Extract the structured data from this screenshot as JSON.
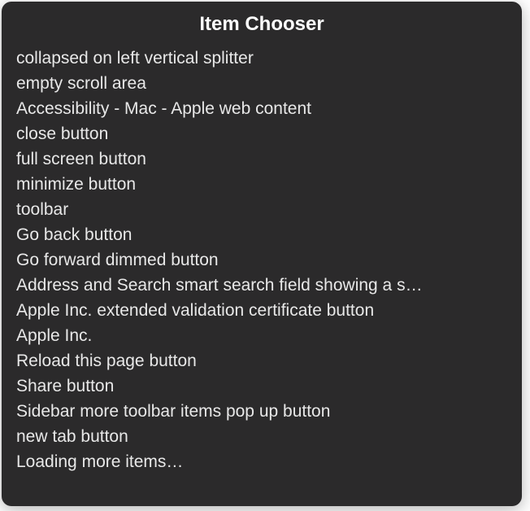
{
  "title": "Item Chooser",
  "items": [
    "collapsed on left vertical splitter",
    "empty scroll area",
    "Accessibility - Mac - Apple web content",
    "close button",
    "full screen button",
    "minimize button",
    "toolbar",
    "Go back button",
    "Go forward dimmed button",
    "Address and Search smart search field showing a s…",
    "Apple Inc. extended validation certificate button",
    "Apple Inc.",
    "Reload this page button",
    "Share button",
    "Sidebar more toolbar items pop up button",
    "new tab button",
    "Loading more items…"
  ]
}
